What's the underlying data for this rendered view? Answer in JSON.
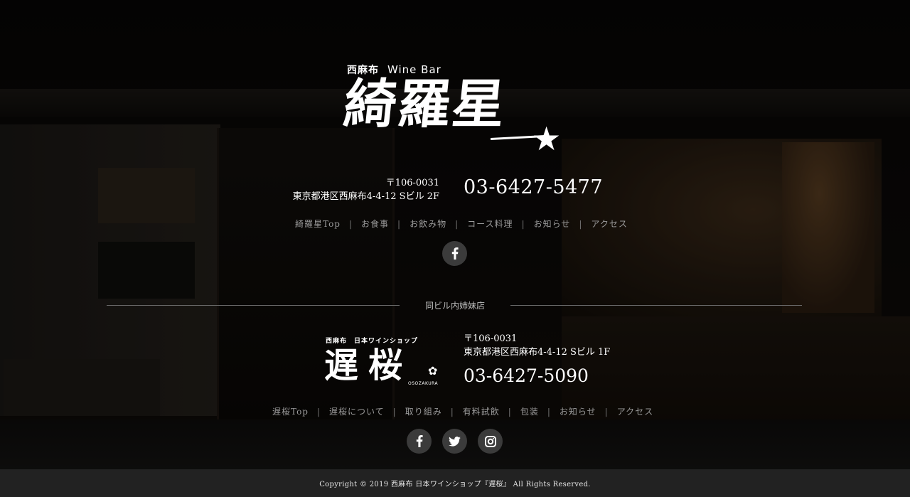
{
  "main_shop": {
    "subtitle": "西麻布",
    "subtitle_en": "Wine Bar",
    "logo_text": "綺羅星",
    "postal": "〒106-0031",
    "address": "東京都港区西麻布4-4-12 Sビル 2F",
    "tel": "03-6427-5477",
    "nav": [
      "綺羅星Top",
      "お食事",
      "お飲み物",
      "コース料理",
      "お知らせ",
      "アクセス"
    ],
    "social": [
      "facebook-icon"
    ]
  },
  "divider_label": "同ビル内姉妹店",
  "sister_shop": {
    "subtitle": "西麻布　日本ワインショップ",
    "logo_text": "遅桜",
    "logo_roman": "OSOZAKURA",
    "postal": "〒106-0031",
    "address": "東京都港区西麻布4-4-12 Sビル 1F",
    "tel": "03-6427-5090",
    "nav": [
      "遅桜Top",
      "遅桜について",
      "取り組み",
      "有料試飲",
      "包装",
      "お知らせ",
      "アクセス"
    ],
    "social": [
      "facebook-icon",
      "twitter-icon",
      "instagram-icon"
    ]
  },
  "footer": {
    "copyright": "Copyright © 2019 西麻布 日本ワインショップ『遅桜』 All Rights Reserved."
  },
  "colors": {
    "background": "#000000",
    "footer_bg": "#222222",
    "nav_text": "#9a9a9a",
    "social_bg": "#3b3b3b"
  }
}
